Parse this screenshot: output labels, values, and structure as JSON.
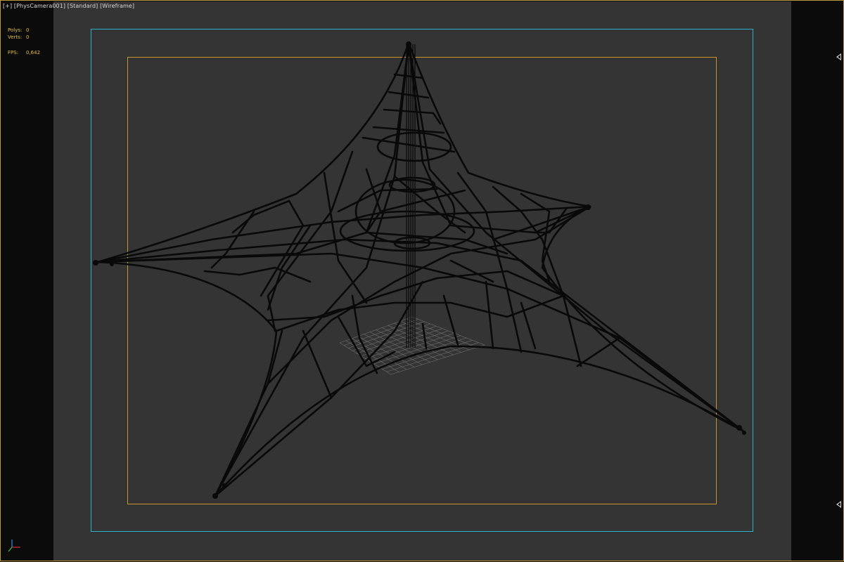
{
  "viewport": {
    "label_menu": "[+]",
    "label_camera": "[PhysCamera001]",
    "label_shading_style": "[Standard]",
    "label_display_mode": "[Wireframe]"
  },
  "stats": {
    "polys_label": "Polys:",
    "polys_value": "0",
    "verts_label": "Verts:",
    "verts_value": "0",
    "fps_label": "FPS:",
    "fps_value": "0,642"
  },
  "icons": {
    "top_scroll_arrow": "triangle-left-icon",
    "bottom_scroll_arrow": "triangle-left-icon",
    "axis_gizmo": "xyz-axis-icon"
  },
  "colors": {
    "background": "#343434",
    "safe_frame": "#2db3c7",
    "live_frame": "#c7952a",
    "stats_text": "#e2c04c",
    "wireframe": "#0a0a0a",
    "grid": "#6a6a6a"
  }
}
